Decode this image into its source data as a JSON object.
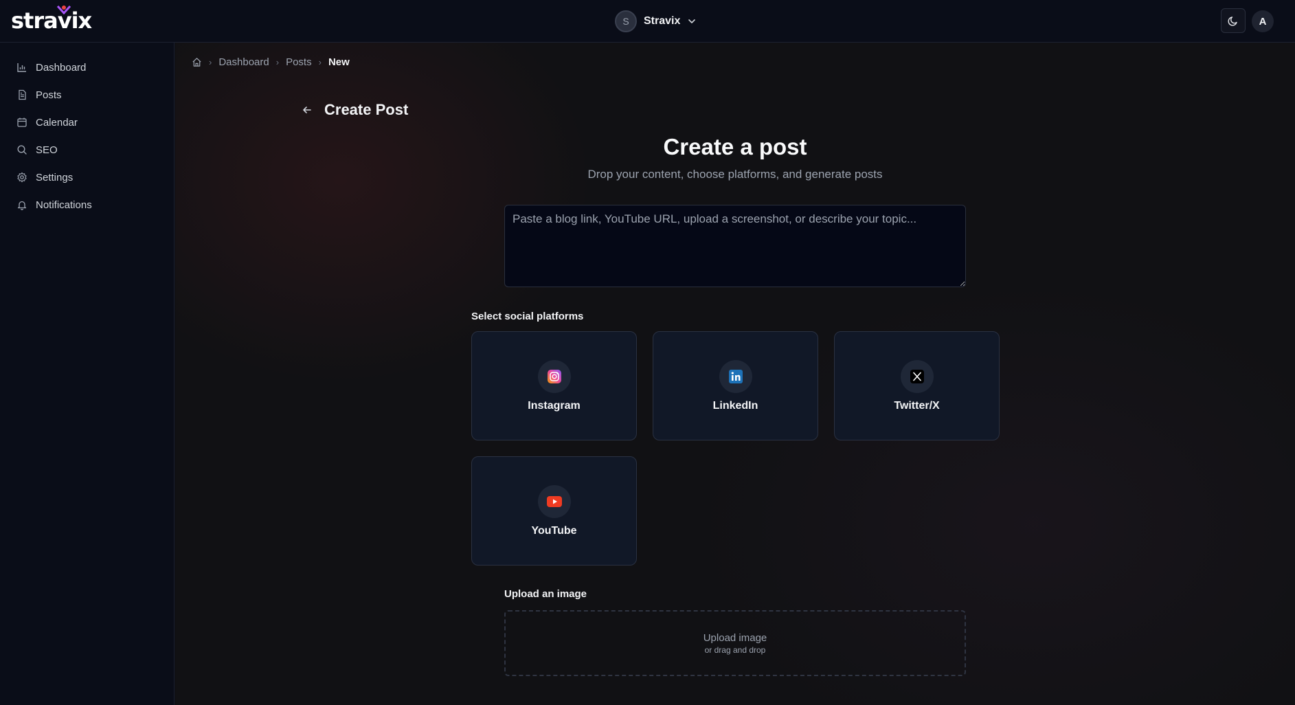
{
  "brand": {
    "logo_text": "stravix"
  },
  "header": {
    "workspace": {
      "avatar_initial": "S",
      "name": "Stravix"
    },
    "user_initial": "A"
  },
  "sidebar": {
    "items": [
      {
        "label": "Dashboard",
        "icon": "bar-chart-icon"
      },
      {
        "label": "Posts",
        "icon": "document-icon"
      },
      {
        "label": "Calendar",
        "icon": "calendar-icon"
      },
      {
        "label": "SEO",
        "icon": "search-icon"
      },
      {
        "label": "Settings",
        "icon": "gear-icon"
      },
      {
        "label": "Notifications",
        "icon": "bell-icon"
      }
    ]
  },
  "breadcrumb": {
    "items": [
      "Dashboard",
      "Posts"
    ],
    "current": "New"
  },
  "page": {
    "title": "Create Post",
    "hero_title": "Create a post",
    "hero_subtitle": "Drop your content, choose platforms, and generate posts"
  },
  "topic_input": {
    "placeholder": "Paste a blog link, YouTube URL, upload a screenshot, or describe your topic...",
    "value": ""
  },
  "platforms": {
    "label": "Select social platforms",
    "items": [
      {
        "name": "Instagram",
        "icon": "instagram-icon"
      },
      {
        "name": "LinkedIn",
        "icon": "linkedin-icon"
      },
      {
        "name": "Twitter/X",
        "icon": "x-icon"
      },
      {
        "name": "YouTube",
        "icon": "youtube-icon"
      }
    ]
  },
  "upload": {
    "label": "Upload an image",
    "title": "Upload image",
    "subtitle": "or drag and drop"
  },
  "colors": {
    "background": "#111114",
    "sidebar": "#0a0d18",
    "card": "#111827",
    "text": "#f3f4f6",
    "muted": "#9ca3af"
  }
}
